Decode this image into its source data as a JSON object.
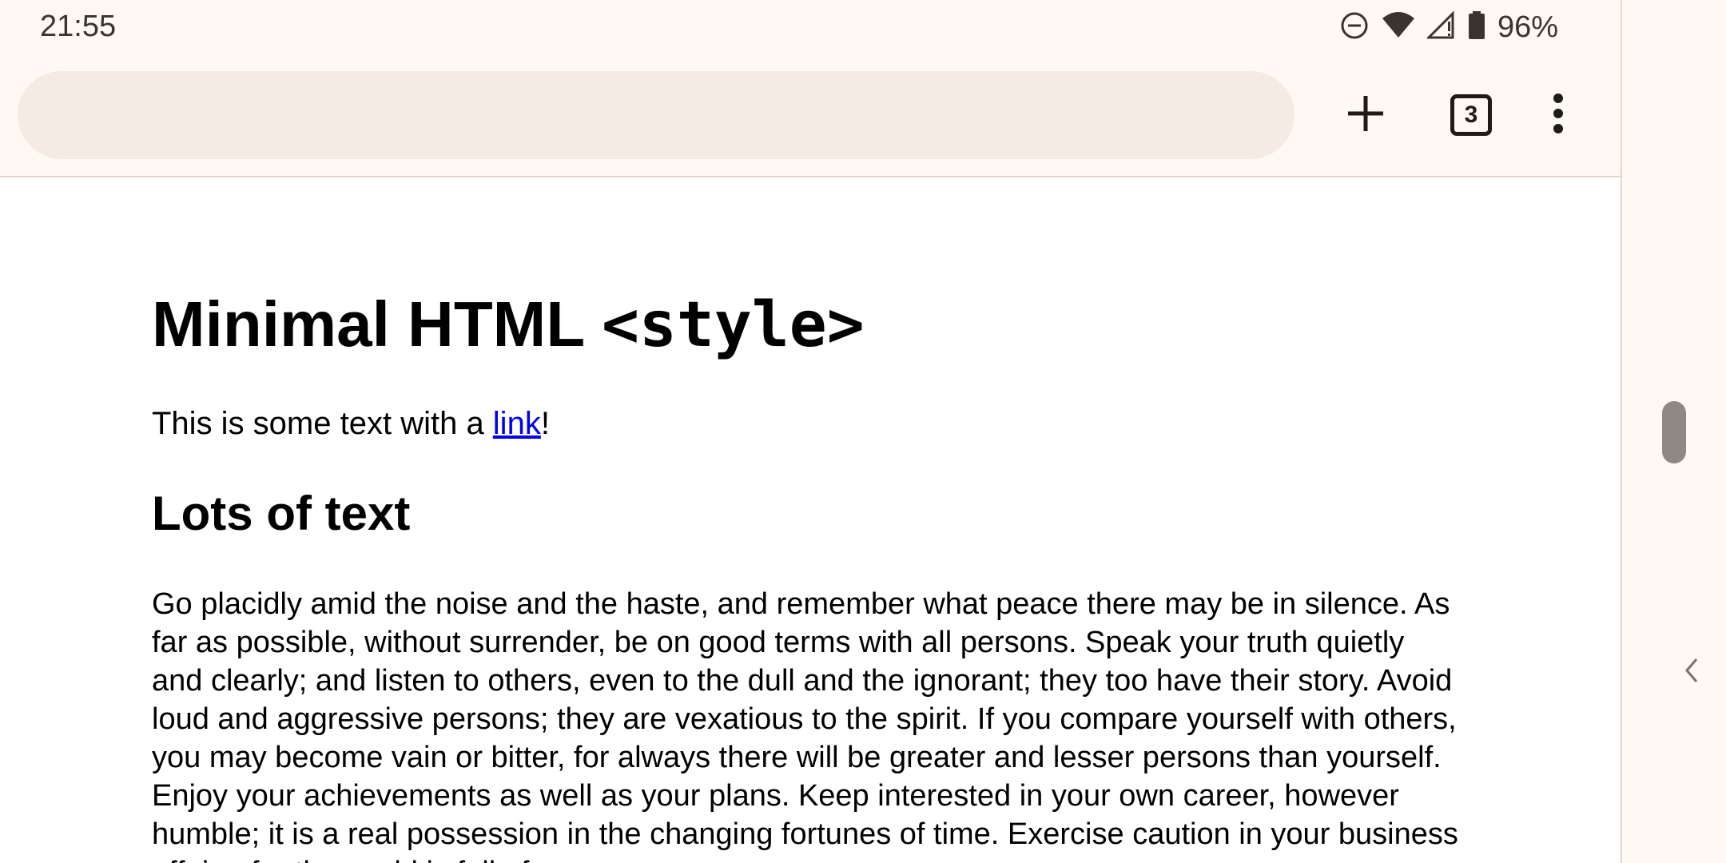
{
  "status_bar": {
    "time": "21:55",
    "battery_percent": "96%",
    "icons": [
      "do-not-disturb-icon",
      "wifi-icon",
      "cell-signal-icon",
      "battery-icon"
    ]
  },
  "toolbar": {
    "omnibox_value": "",
    "new_tab_icon": "plus-icon",
    "tab_count": "3",
    "menu_icon": "more-vert-icon"
  },
  "page": {
    "title_text": "Minimal HTML ",
    "title_code": "<style>",
    "intro_before": "This is some text with a ",
    "intro_link": "link",
    "intro_after": "!",
    "section_heading": "Lots of text",
    "body_paragraph": "Go placidly amid the noise and the haste, and remember what peace there may be in silence. As far as possible, without surrender, be on good terms with all persons. Speak your truth quietly and clearly; and listen to others, even to the dull and the ignorant; they too have their story. Avoid loud and aggressive persons; they are vexatious to the spirit. If you compare yourself with others, you may become vain or bitter, for always there will be greater and lesser persons than yourself. Enjoy your achievements as well as your plans. Keep interested in your own career, however humble; it is a real possession in the changing fortunes of time. Exercise caution in your business affairs; for the world is full of"
  },
  "colors": {
    "link": "#0000ee",
    "chrome_bg": "#fff8f3",
    "omnibox_bg": "#f4ece3"
  }
}
